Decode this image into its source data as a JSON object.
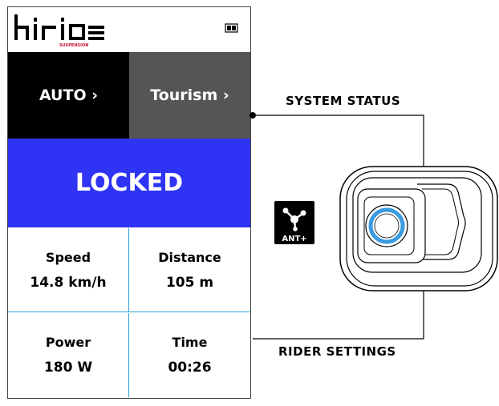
{
  "device": {
    "logo_text": "hiride",
    "logo_subtext": "SUSPENSION",
    "mode_auto": "AUTO ›",
    "mode_profile": "Tourism ›",
    "status": "LOCKED",
    "metrics": [
      {
        "label": "Speed",
        "value": "14.8 km/h"
      },
      {
        "label": "Distance",
        "value": "105 m"
      },
      {
        "label": "Power",
        "value": "180 W"
      },
      {
        "label": "Time",
        "value": "00:26"
      }
    ]
  },
  "callouts": {
    "system_status": "SYSTEM STATUS",
    "rider_settings": "RIDER SETTINGS"
  },
  "ant_label": "ANT+",
  "colors": {
    "status_blue": "#2f33f4",
    "divider_blue": "#2aa5d8",
    "button_light_blue": "#3b9be0"
  }
}
